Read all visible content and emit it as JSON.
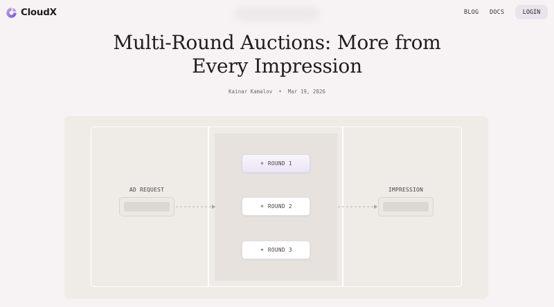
{
  "app": {
    "name": "CloudX"
  },
  "nav": {
    "blog": "BLOG",
    "docs": "DOCS",
    "login": "LOGIN"
  },
  "article": {
    "title_line1": "Multi-Round Auctions: More from",
    "title_line2": "Every Impression",
    "author": "Kainar Kamalov",
    "separator": "•",
    "date": "Mar 19, 2026"
  },
  "diagram": {
    "input_label": "AD REQUEST",
    "output_label": "IMPRESSION",
    "rounds": [
      {
        "label": "ROUND 1",
        "icon": "sparkle-icon"
      },
      {
        "label": "ROUND 2",
        "icon": "sparkle-icon"
      },
      {
        "label": "ROUND 3",
        "icon": "sparkle-icon"
      }
    ]
  },
  "colors": {
    "page_bg": "#f7f3f4",
    "logo_gradient": [
      "#b58ee8",
      "#7b56d6"
    ],
    "round_highlight": "#ebe4f5",
    "diagram_bg": "#efebe6"
  }
}
